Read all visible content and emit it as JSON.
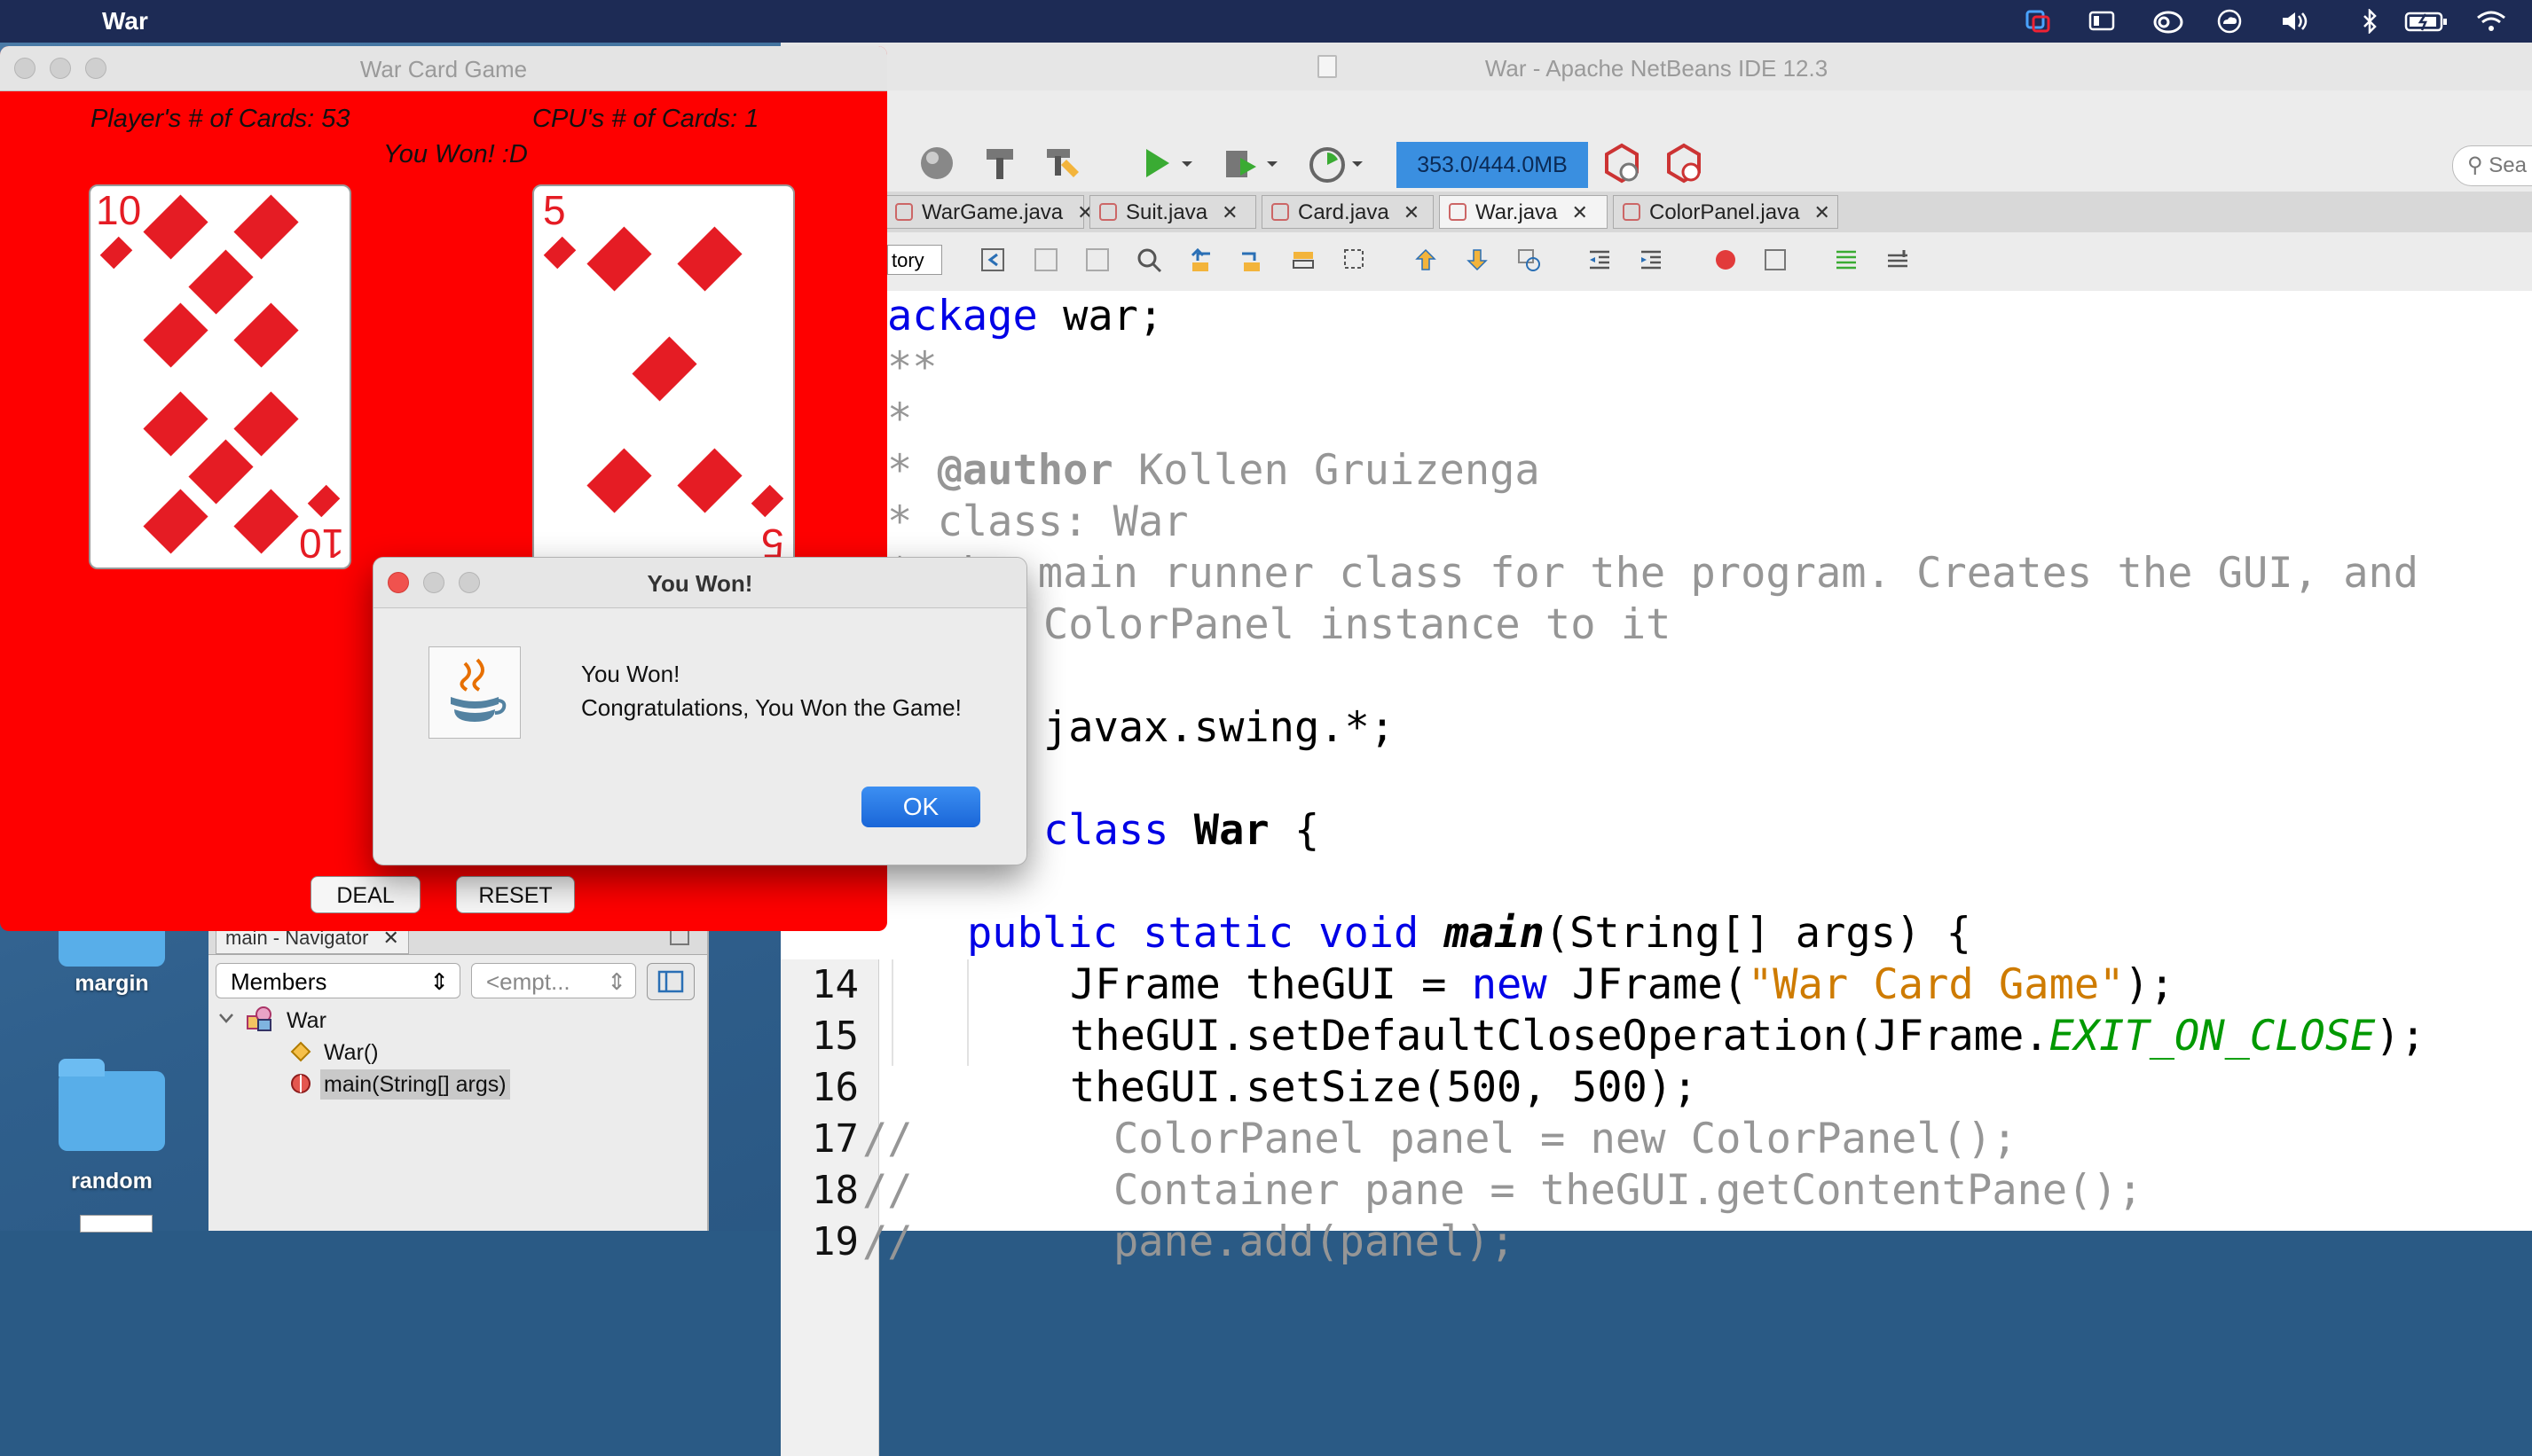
{
  "menubar": {
    "apple_glyph": "",
    "app_name": "War",
    "status_icons": [
      "teamviewer-icon",
      "display-icon",
      "creative-cloud-icon",
      "cloud-icon",
      "volume-icon",
      "bluetooth-icon",
      "battery-icon",
      "wifi-icon"
    ]
  },
  "desktop": {
    "folders": [
      {
        "label": "margin"
      },
      {
        "label": "random"
      }
    ]
  },
  "netbeans": {
    "title": "War - Apache NetBeans IDE 12.3",
    "memory": "353.0/444.0MB",
    "search_placeholder": "Sea",
    "tabs": [
      {
        "label": "WarGame.java",
        "active": false
      },
      {
        "label": "Suit.java",
        "active": false
      },
      {
        "label": "Card.java",
        "active": false
      },
      {
        "label": "War.java",
        "active": true
      },
      {
        "label": "ColorPanel.java",
        "active": false
      }
    ],
    "history_label": "tory",
    "code": {
      "l_pkg_kw": "ackage",
      "l_pkg_rest": " war;",
      "l_javadoc_open": "**",
      "l_star": "*",
      "l_author_star": "* ",
      "l_author_tag": "@author",
      "l_author_name": " Kollen Gruizenga",
      "l_class_desc": "* class: War",
      "l_desc1": "* the main runner class for the program. Creates the GUI, and",
      "l_desc2": "ColorPanel instance to it",
      "l_import": "javax.swing.*;",
      "l_class_kw": "class",
      "l_class_name": " War",
      "l_class_brace": " {",
      "l_main_kw": "public static void",
      "l_main_name": "main",
      "l_main_rest": "(String[] args) {",
      "l14_a": "JFrame theGUI = ",
      "l14_new": "new",
      "l14_b": " JFrame(",
      "l14_str": "\"War Card Game\"",
      "l14_c": ");",
      "l15_a": "theGUI.setDefaultCloseOperation(JFrame.",
      "l15_const": "EXIT_ON_CLOSE",
      "l15_b": ");",
      "l16": "theGUI.setSize(500, 500);",
      "l17": "//        ColorPanel panel = new ColorPanel();",
      "l18": "//        Container pane = theGUI.getContentPane();",
      "l19": "//        pane.add(panel);"
    },
    "line_numbers": [
      "14",
      "15",
      "16",
      "17",
      "18",
      "19"
    ]
  },
  "navigator": {
    "tab_label": "main - Navigator",
    "filter_label": "Members",
    "filter2_label": "<empt...",
    "tree": {
      "class_name": "War",
      "constructor": "War()",
      "method": "main(String[] args)"
    }
  },
  "game": {
    "title": "War Card Game",
    "player_cards": "Player's # of Cards: 53",
    "cpu_cards": "CPU's # of Cards: 1",
    "result": "You Won! :D",
    "player_card": {
      "rank": "10",
      "suit": "diamonds"
    },
    "cpu_card": {
      "rank": "5",
      "suit": "diamonds"
    },
    "deal_label": "DEAL",
    "reset_label": "RESET",
    "colors": {
      "panel": "#fe0000",
      "suit": "#e51c24"
    }
  },
  "dialog": {
    "title": "You Won!",
    "line1": "You Won!",
    "line2": "Congratulations, You Won the Game!",
    "ok_label": "OK",
    "icon": "java-icon"
  }
}
